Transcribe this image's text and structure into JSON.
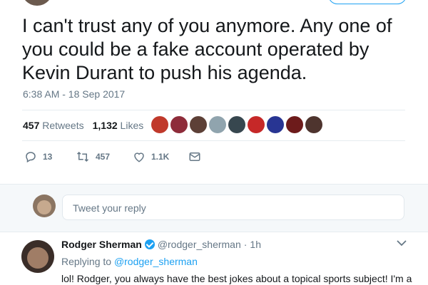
{
  "tweet": {
    "text": "I can't trust any of you anymore. Any one of you could be a fake account operated by Kevin Durant to push his agenda.",
    "timestamp": "6:38 AM - 18 Sep 2017",
    "retweets_count": "457",
    "retweets_label": "Retweets",
    "likes_count": "1,132",
    "likes_label": "Likes",
    "liker_colors": [
      "#c0392b",
      "#8e2c3a",
      "#5d4037",
      "#90a4ae",
      "#37474f",
      "#c62828",
      "#283593",
      "#6d1b1b",
      "#4e342e"
    ],
    "actions": {
      "reply_count": "13",
      "retweet_count": "457",
      "like_count": "1.1K"
    }
  },
  "composer": {
    "placeholder": "Tweet your reply"
  },
  "reply": {
    "name": "Rodger Sherman",
    "handle": "@rodger_sherman",
    "separator": "·",
    "time": "1h",
    "replying_prefix": "Replying to",
    "replying_to": "@rodger_sherman",
    "text": "lol! Rodger, you always have the best jokes about a topical sports subject! I'm a"
  },
  "colors": {
    "accent": "#1da1f2",
    "muted": "#657786",
    "text": "#14171a"
  }
}
